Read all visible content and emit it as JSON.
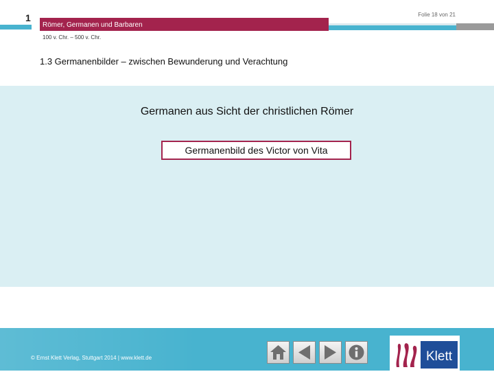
{
  "header": {
    "chapter": "1",
    "title": "Römer, Germanen und Barbaren",
    "period": "100 v. Chr. – 500 v. Chr.",
    "slide_counter": "Folie 18 von 21"
  },
  "section": {
    "title": "1.3 Germanenbilder – zwischen Bewunderung und Verachtung"
  },
  "main": {
    "heading": "Germanen aus Sicht der christlichen Römer",
    "link_label": "Germanenbild des Victor von Vita"
  },
  "footer": {
    "copyright": "© Ernst Klett Verlag, Stuttgart 2014 | www.klett.de",
    "buttons": [
      "home-icon",
      "arrow-left-icon",
      "arrow-right-icon",
      "info-icon"
    ],
    "logo_text": "Klett"
  },
  "colors": {
    "accent": "#a3234d",
    "blue": "#48b3cf",
    "panel": "#daeff3",
    "gray": "#9a9a9a"
  }
}
